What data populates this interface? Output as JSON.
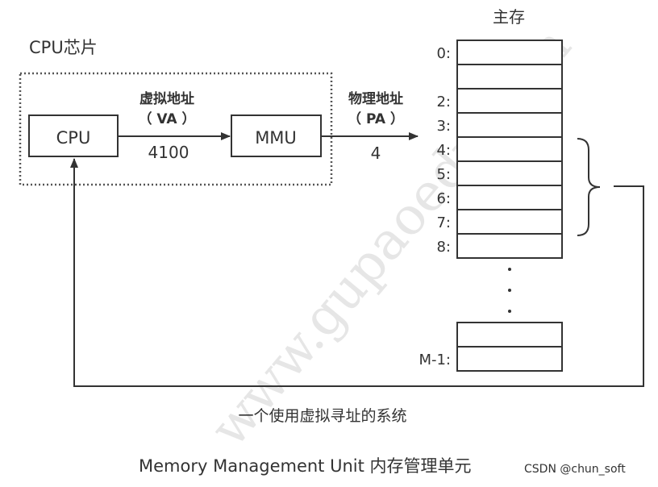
{
  "diagram": {
    "chip_label": "CPU芯片",
    "cpu_label": "CPU",
    "mmu_label": "MMU",
    "va": {
      "title": "虚拟地址",
      "abbr": "（ VA ）",
      "value": "4100"
    },
    "pa": {
      "title": "物理地址",
      "abbr": "（ PA ）",
      "value": "4"
    },
    "memory": {
      "title": "主存",
      "rows": [
        {
          "label": "0:"
        },
        {
          "label": ""
        },
        {
          "label": "2:"
        },
        {
          "label": "3:"
        },
        {
          "label": "4:"
        },
        {
          "label": "5:"
        },
        {
          "label": "6:"
        },
        {
          "label": "7:"
        },
        {
          "label": "8:"
        }
      ],
      "ellipsis": "·",
      "tail_rows": [
        {
          "label": ""
        },
        {
          "label": "M-1:"
        }
      ],
      "bracket_rows": [
        "4:",
        "5:",
        "6:",
        "7:"
      ]
    },
    "feedback_caption": "一个使用虚拟寻址的系统",
    "footer_caption": "Memory Management Unit  内存管理单元",
    "credit": "CSDN @chun_soft",
    "watermark": "www.gupaoedu.com"
  },
  "colors": {
    "line": "#333333",
    "dotted": "#555555",
    "watermark": "#e6e6e6"
  }
}
